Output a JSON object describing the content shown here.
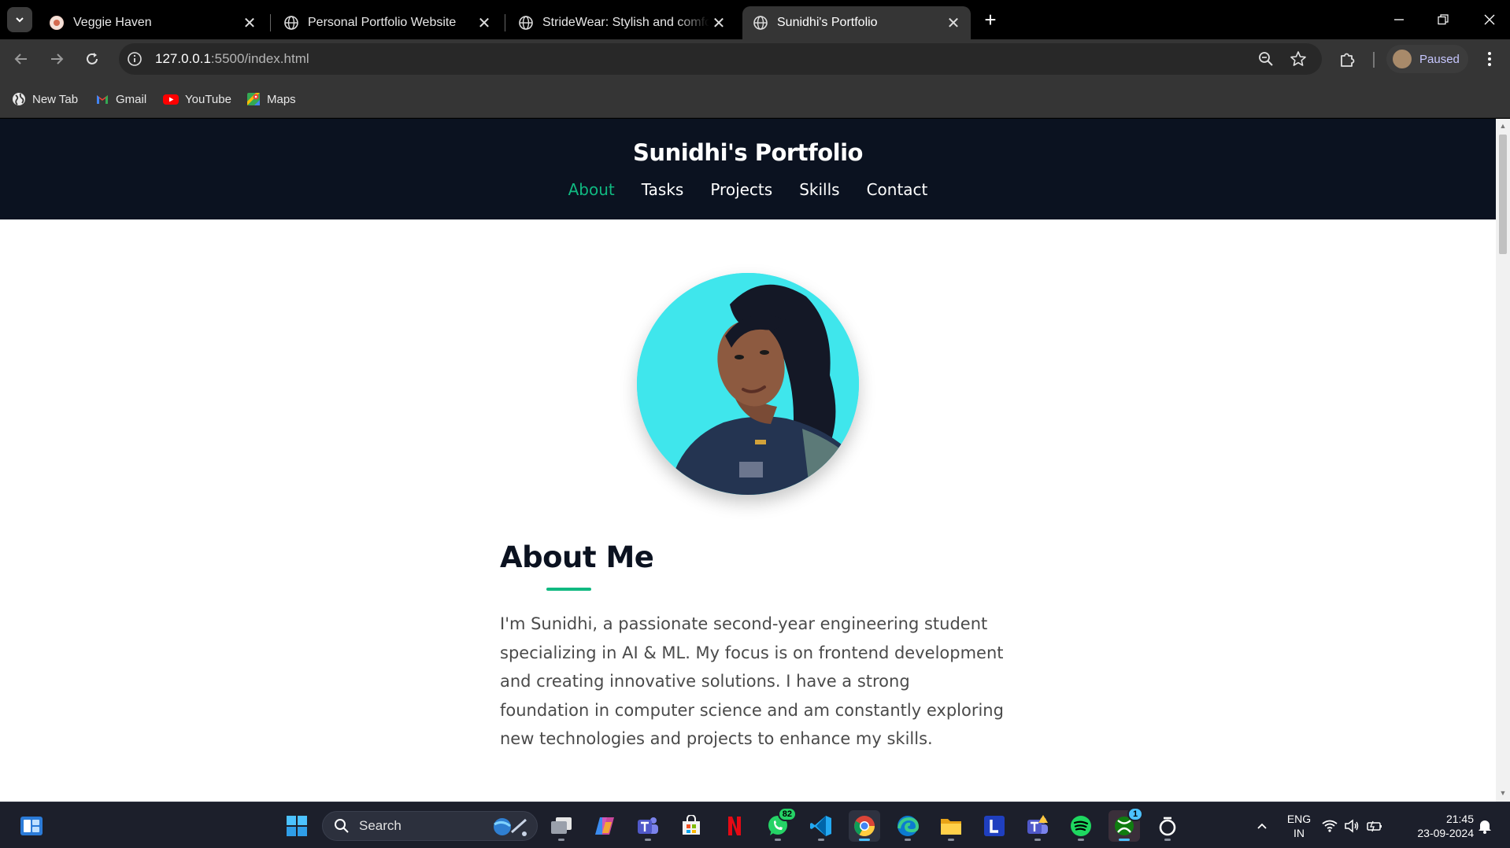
{
  "browser": {
    "tabs": [
      {
        "title": "Veggie Haven",
        "active": false
      },
      {
        "title": "Personal Portfolio Website",
        "active": false
      },
      {
        "title": "StrideWear: Stylish and comfort",
        "active": false
      },
      {
        "title": "Sunidhi's Portfolio",
        "active": true
      }
    ],
    "address": {
      "host": "127.0.0.1",
      "path": ":5500/index.html"
    },
    "profile_label": "Paused",
    "bookmarks": [
      {
        "label": "New Tab",
        "icon": "globe-icon"
      },
      {
        "label": "Gmail",
        "icon": "gmail-icon"
      },
      {
        "label": "YouTube",
        "icon": "youtube-icon"
      },
      {
        "label": "Maps",
        "icon": "maps-icon"
      }
    ]
  },
  "site": {
    "title": "Sunidhi's Portfolio",
    "nav": [
      "About",
      "Tasks",
      "Projects",
      "Skills",
      "Contact"
    ],
    "active_nav": "About",
    "about": {
      "heading": "About Me",
      "text": "I'm Sunidhi, a passionate second-year engineering student specializing in AI & ML. My focus is on frontend development and creating innovative solutions. I have a strong foundation in computer science and am constantly exploring new technologies and projects to enhance my skills."
    }
  },
  "colors": {
    "header_bg": "#0b1220",
    "accent": "#10b981",
    "avatar_bg": "#3fe6ec"
  },
  "taskbar": {
    "search_label": "Search",
    "badges": {
      "whatsapp": "82",
      "xbox": "1"
    },
    "language": {
      "line1": "ENG",
      "line2": "IN"
    },
    "time": "21:45",
    "date": "23-09-2024"
  }
}
